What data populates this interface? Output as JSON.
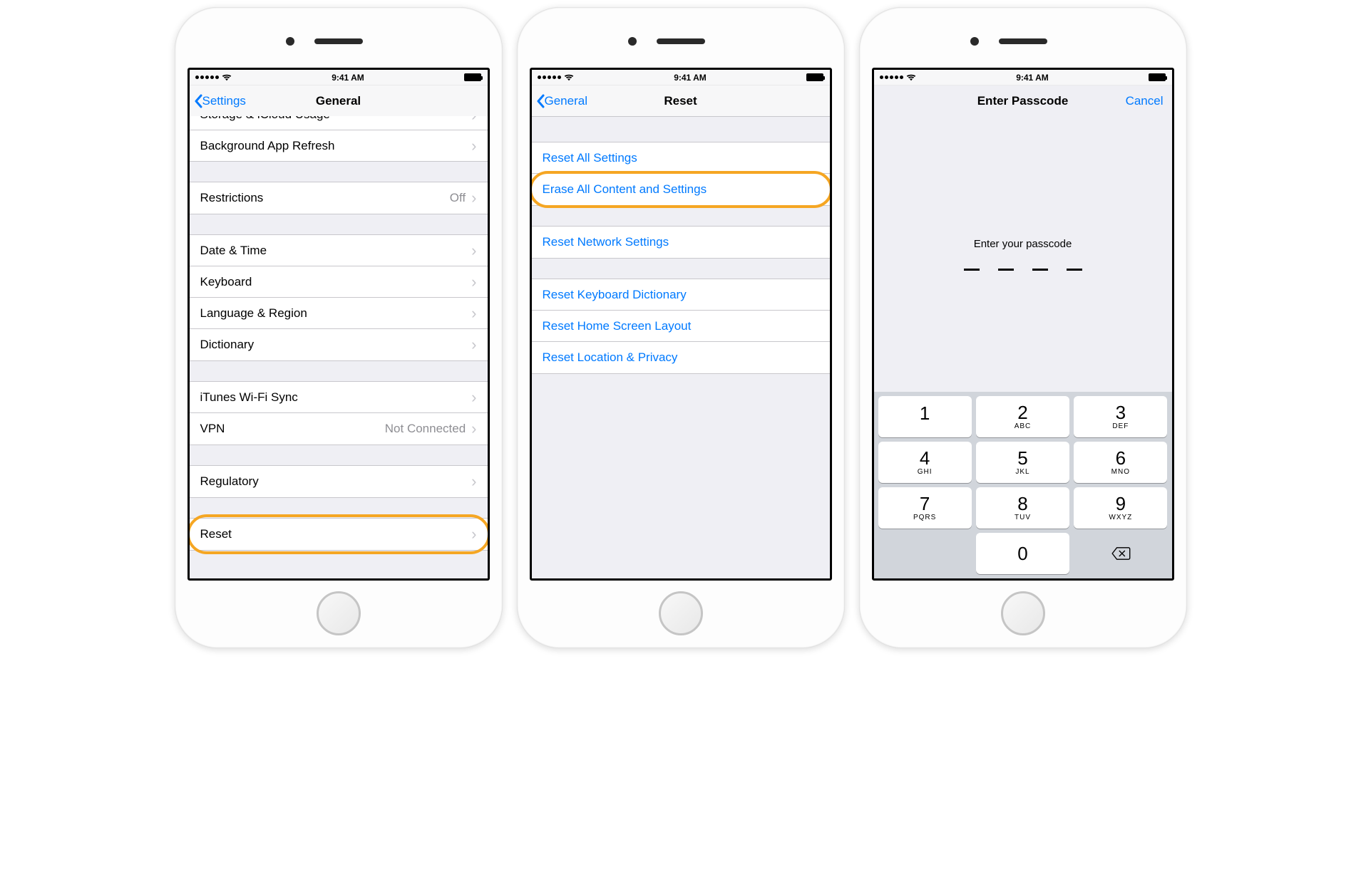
{
  "status": {
    "signal_dots": "•••••",
    "wifi": true,
    "time": "9:41 AM",
    "battery_full": true
  },
  "screens": {
    "general": {
      "back_label": "Settings",
      "title": "General",
      "partial_top": "Storage & iCloud Usage",
      "rows": {
        "bg_refresh": "Background App Refresh",
        "restrictions": "Restrictions",
        "restrictions_value": "Off",
        "date_time": "Date & Time",
        "keyboard": "Keyboard",
        "language_region": "Language & Region",
        "dictionary": "Dictionary",
        "itunes_wifi": "iTunes Wi-Fi Sync",
        "vpn": "VPN",
        "vpn_value": "Not Connected",
        "regulatory": "Regulatory",
        "reset": "Reset"
      }
    },
    "reset": {
      "back_label": "General",
      "title": "Reset",
      "rows": {
        "reset_all": "Reset All Settings",
        "erase_all": "Erase All Content and Settings",
        "reset_network": "Reset Network Settings",
        "reset_keyboard_dict": "Reset Keyboard Dictionary",
        "reset_home": "Reset Home Screen Layout",
        "reset_location": "Reset Location & Privacy"
      }
    },
    "passcode": {
      "title": "Enter Passcode",
      "cancel": "Cancel",
      "prompt": "Enter your passcode",
      "keys": {
        "k1": {
          "num": "1",
          "letters": ""
        },
        "k2": {
          "num": "2",
          "letters": "ABC"
        },
        "k3": {
          "num": "3",
          "letters": "DEF"
        },
        "k4": {
          "num": "4",
          "letters": "GHI"
        },
        "k5": {
          "num": "5",
          "letters": "JKL"
        },
        "k6": {
          "num": "6",
          "letters": "MNO"
        },
        "k7": {
          "num": "7",
          "letters": "PQRS"
        },
        "k8": {
          "num": "8",
          "letters": "TUV"
        },
        "k9": {
          "num": "9",
          "letters": "WXYZ"
        },
        "k0": {
          "num": "0",
          "letters": ""
        }
      }
    }
  }
}
